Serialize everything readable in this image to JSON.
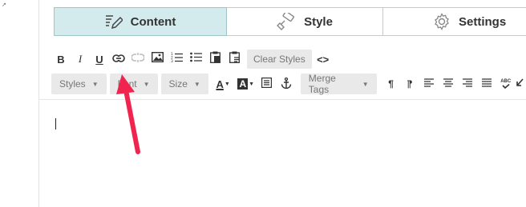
{
  "corner_glyph": "↗",
  "tabs": [
    {
      "label": "Content",
      "icon": "content-pen-icon",
      "active": true
    },
    {
      "label": "Style",
      "icon": "paint-roller-icon",
      "active": false
    },
    {
      "label": "Settings",
      "icon": "gear-icon",
      "active": false
    }
  ],
  "toolbar_row1": {
    "bold": "B",
    "italic": "I",
    "underline": "U",
    "clear_styles": "Clear Styles",
    "source": "<>"
  },
  "toolbar_row2": {
    "styles": "Styles",
    "font": "Font",
    "size": "Size",
    "merge_tags": "Merge Tags",
    "text_color_letter": "A",
    "bg_color_letter": "A",
    "paragraph": "¶",
    "spellcheck": "ABC"
  },
  "colors": {
    "active_tab_bg": "#d4ebee",
    "annotation_arrow": "#f0244e"
  }
}
